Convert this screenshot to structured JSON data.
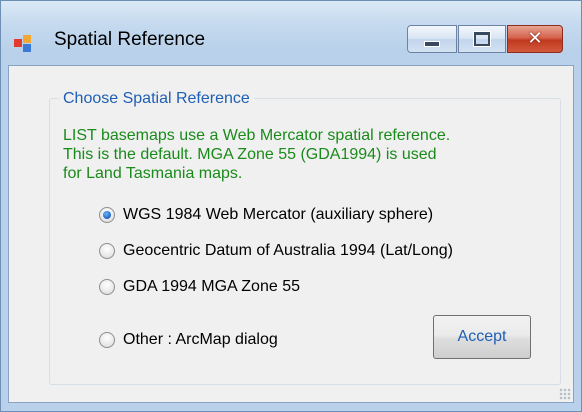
{
  "window": {
    "title": "Spatial Reference",
    "icon": "app-window-icon",
    "controls": {
      "minimize": "minimize-icon",
      "maximize": "maximize-icon",
      "close_glyph": "✕"
    }
  },
  "group": {
    "title": "Choose Spatial Reference",
    "description": "LIST basemaps use a Web Mercator spatial reference.\nThis is the default. MGA Zone 55 (GDA1994) is used\nfor Land Tasmania maps."
  },
  "options": [
    {
      "label": "WGS 1984 Web Mercator (auxiliary sphere)",
      "checked": true
    },
    {
      "label": "Geocentric Datum of Australia 1994 (Lat/Long)",
      "checked": false
    },
    {
      "label": "GDA 1994 MGA Zone 55",
      "checked": false
    },
    {
      "label": "Other : ArcMap dialog",
      "checked": false
    }
  ],
  "buttons": {
    "accept": "Accept"
  },
  "colors": {
    "group_title": "#1f5fb4",
    "description": "#1a8a1a",
    "accept_text": "#1f5fb4"
  }
}
